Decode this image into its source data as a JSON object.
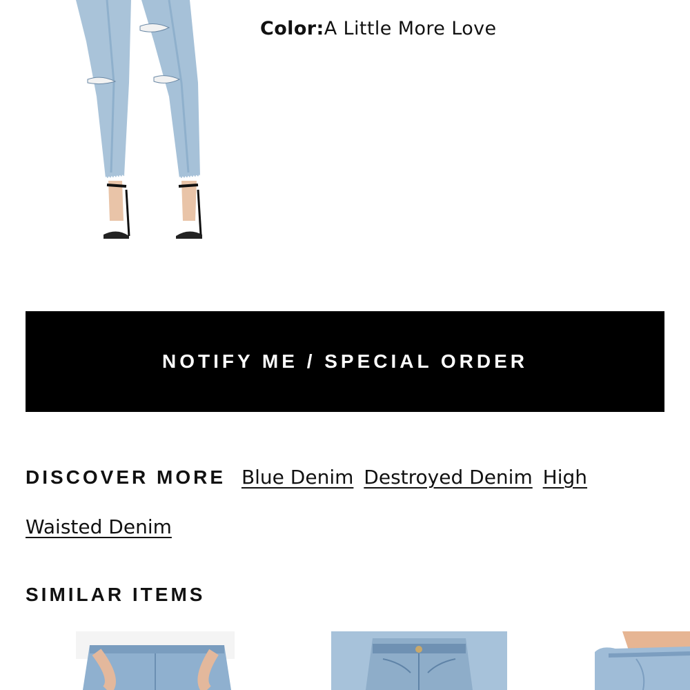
{
  "product": {
    "color_label": "Color:",
    "color_value": "A Little More Love"
  },
  "actions": {
    "notify_label": "NOTIFY ME / SPECIAL ORDER"
  },
  "discover": {
    "heading": "DISCOVER MORE",
    "links": [
      "Blue Denim",
      "Destroyed Denim",
      "High Waisted Denim"
    ]
  },
  "similar": {
    "heading": "SIMILAR ITEMS"
  },
  "colors": {
    "button_bg": "#000000",
    "denim_light": "#a9c3d9",
    "denim_mid": "#7fa2c2"
  }
}
